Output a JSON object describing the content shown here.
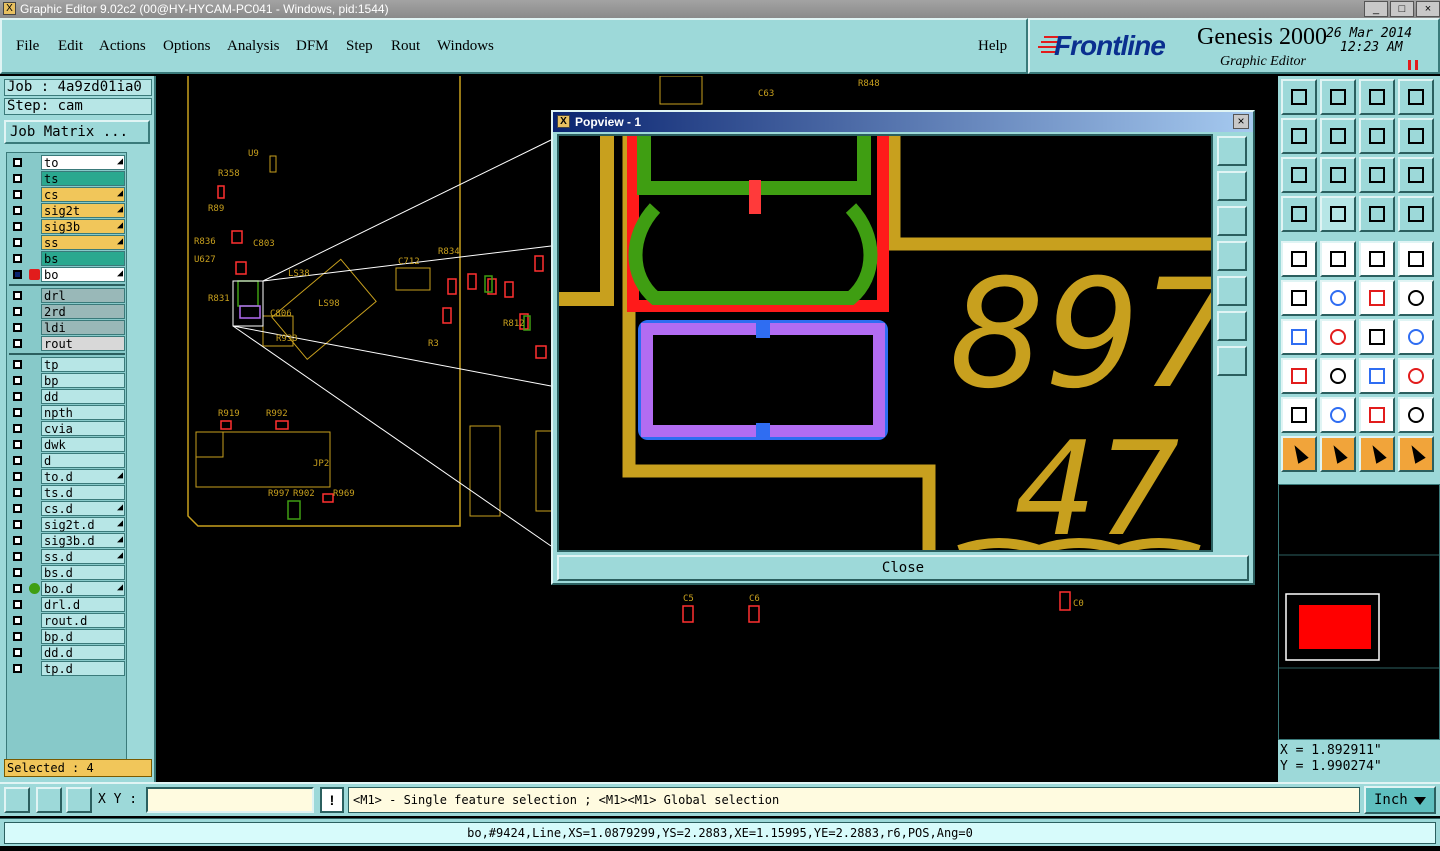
{
  "window": {
    "title": "Graphic Editor 9.02c2 (00@HY-HYCAM-PC041 - Windows, pid:1544)",
    "controls": [
      "_",
      "□",
      "×"
    ]
  },
  "menu": [
    "File",
    "Edit",
    "Actions",
    "Options",
    "Analysis",
    "DFM",
    "Step",
    "Rout",
    "Windows"
  ],
  "help_label": "Help",
  "brand": {
    "logo": "Frontline",
    "product": "Genesis 2000",
    "subtitle": "Graphic Editor",
    "date": "26 Mar 2014",
    "time": "12:23 AM",
    "pause_icon": "pause-icon"
  },
  "job": {
    "job_label": "Job : 4a9zd01ia0",
    "step_label": "Step: cam",
    "matrix_button": "Job Matrix ..."
  },
  "layers": {
    "board": [
      {
        "name": "to",
        "color": "#ffffff",
        "arrow": true
      },
      {
        "name": "ts",
        "color": "#2aa88f",
        "arrow": false
      },
      {
        "name": "cs",
        "color": "#f1c65a",
        "arrow": true
      },
      {
        "name": "sig2t",
        "color": "#f1c65a",
        "arrow": true
      },
      {
        "name": "sig3b",
        "color": "#f1c65a",
        "arrow": true
      },
      {
        "name": "ss",
        "color": "#f1c65a",
        "arrow": true
      },
      {
        "name": "bs",
        "color": "#2aa88f",
        "arrow": false
      },
      {
        "name": "bo",
        "color": "#ffffff",
        "arrow": true
      }
    ],
    "drill": [
      {
        "name": "drl",
        "color": "#99b8b8"
      },
      {
        "name": "2rd",
        "color": "#99b8b8"
      },
      {
        "name": "ldi",
        "color": "#99b8b8"
      },
      {
        "name": "rout",
        "color": "#d8d8d8"
      }
    ],
    "misc": [
      {
        "name": "tp",
        "arrow": false
      },
      {
        "name": "bp",
        "arrow": false
      },
      {
        "name": "dd",
        "arrow": false
      },
      {
        "name": "npth",
        "arrow": false
      },
      {
        "name": "cvia",
        "arrow": false
      },
      {
        "name": "dwk",
        "arrow": false
      },
      {
        "name": "d",
        "arrow": false
      },
      {
        "name": "to.d",
        "arrow": true
      },
      {
        "name": "ts.d",
        "arrow": false
      },
      {
        "name": "cs.d",
        "arrow": true
      },
      {
        "name": "sig2t.d",
        "arrow": true
      },
      {
        "name": "sig3b.d",
        "arrow": true
      },
      {
        "name": "ss.d",
        "arrow": true
      },
      {
        "name": "bs.d",
        "arrow": false
      },
      {
        "name": "bo.d",
        "arrow": true
      },
      {
        "name": "drl.d",
        "arrow": false
      },
      {
        "name": "rout.d",
        "arrow": false
      },
      {
        "name": "bp.d",
        "arrow": false
      },
      {
        "name": "dd.d",
        "arrow": false
      },
      {
        "name": "tp.d",
        "arrow": false
      }
    ]
  },
  "selected": "Selected : 4",
  "popview": {
    "title": "Popview - 1",
    "close_label": "Close",
    "close_x": "×",
    "digits_row1": "897",
    "digits_row2": "47"
  },
  "pcb_labels": [
    "U9",
    "R358",
    "R89",
    "C803",
    "R836",
    "U627",
    "R831",
    "R812",
    "C712",
    "R834",
    "LS38",
    "LS98",
    "C806",
    "R933",
    "R919",
    "R992",
    "R902",
    "R997",
    "JP2",
    "R969",
    "C63",
    "C5",
    "C6",
    "C0",
    "R3",
    "R848"
  ],
  "toolbox": {
    "icons": [
      "home-icon",
      "zoom-home-icon",
      "undo-icon",
      "redo-icon",
      "ratio-icon",
      "query-icon",
      "grid-icon",
      "layer-icon",
      "feature-icon",
      "pad-icon",
      "line-icon",
      "arc-icon",
      "surface-icon",
      "text-icon",
      "select-icon",
      "move-icon",
      "net-icon",
      "route-icon"
    ]
  },
  "coords": {
    "x": "X = 1.892911\"",
    "y": "Y = 1.990274\""
  },
  "bottom": {
    "xy_label": "X Y :",
    "xy_value": "",
    "help_glyph": "!",
    "prompt": "<M1> - Single feature selection ; <M1><M1> Global selection",
    "units": "Inch"
  },
  "status": "bo,#9424,Line,XS=1.0879299,YS=2.2883,XE=1.15995,YE=2.2883,r6,POS,Ang=0",
  "colors": {
    "panel": "#9dd9d9",
    "gold": "#c8a01e",
    "red": "#ff1a1a",
    "green": "#3f9e12",
    "violet": "#b26cf2",
    "blue": "#2f6df2"
  }
}
